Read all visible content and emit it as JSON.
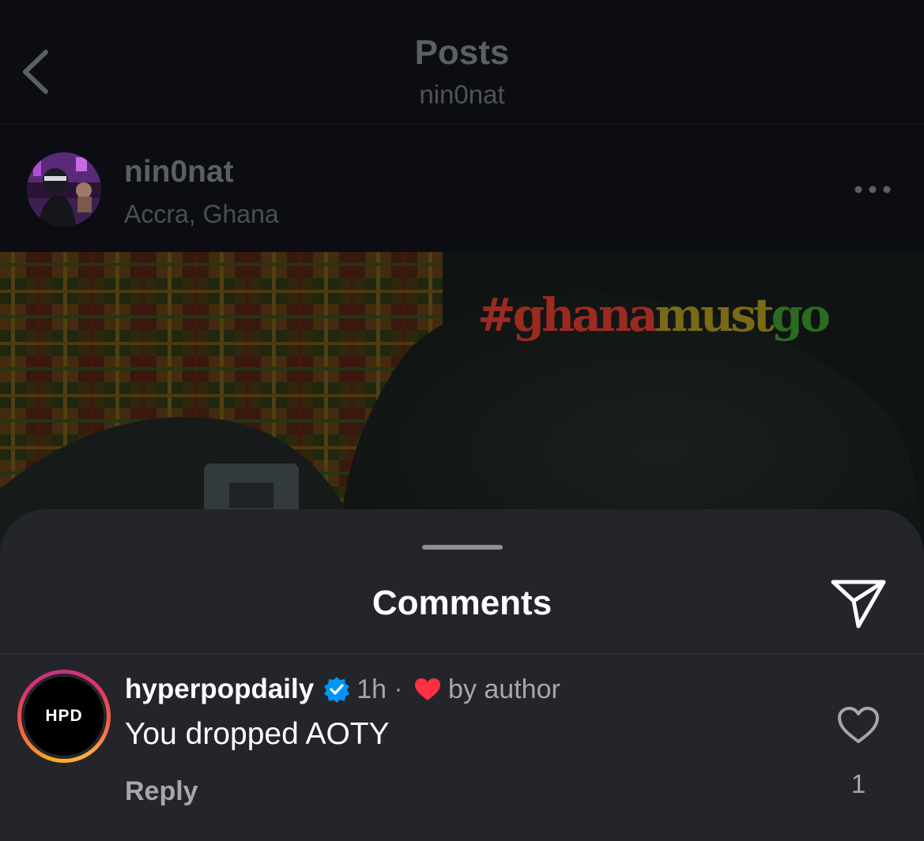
{
  "header": {
    "title": "Posts",
    "subtitle": "nin0nat",
    "back_icon": "chevron-left-icon"
  },
  "post": {
    "username": "nin0nat",
    "location": "Accra, Ghana",
    "more_icon": "ellipsis-icon",
    "image_hashtag": {
      "part1": "#ghana",
      "part2": "must",
      "part3": "go"
    },
    "hashtag_colors": [
      "#9b2a20",
      "#7a6a16",
      "#2b6a1f"
    ]
  },
  "comments_sheet": {
    "title": "Comments",
    "share_icon": "paper-plane-icon",
    "comments": [
      {
        "avatar_text": "HPD",
        "username": "hyperpopdaily",
        "verified": true,
        "time": "1h",
        "separator": "·",
        "liked_by_author_label": "by author",
        "text": "You dropped AOTY",
        "reply_label": "Reply",
        "like_count": "1"
      }
    ]
  },
  "colors": {
    "sheet_background": "#23252b",
    "verified_blue": "#0095f6",
    "heart_red": "#ff3040"
  }
}
